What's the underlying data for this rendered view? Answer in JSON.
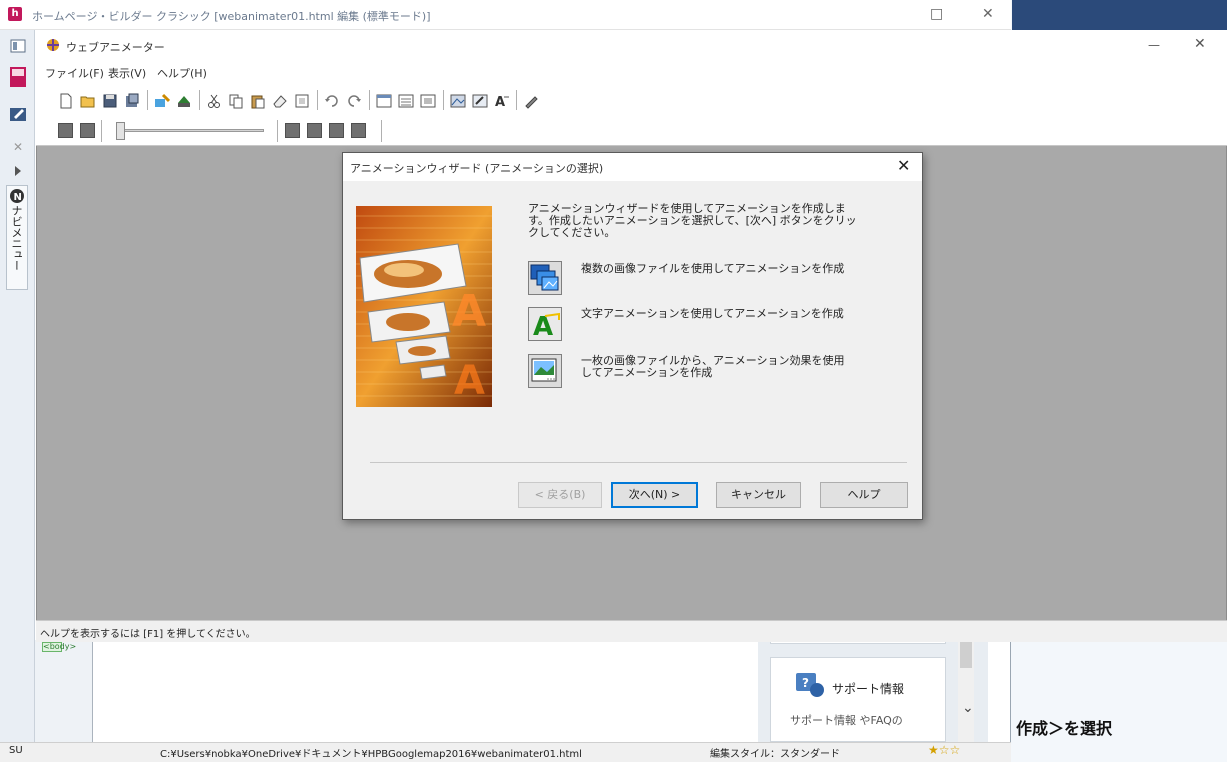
{
  "host": {
    "title": "ホームページ・ビルダー クラシック  [webanimater01.html 編集 (標準モード)]",
    "min_glyph": "□",
    "close_glyph": "✕",
    "navi_label": "ナビメニュー",
    "tag_label": "<body>",
    "support_title": "サポート情報",
    "support_sub": "サポート情報 やFAQの",
    "chev": "⌄",
    "status": {
      "mode": "SU",
      "path": "C:¥Users¥nobka¥OneDrive¥ドキュメント¥HPBGooglemap2016¥webanimater01.html",
      "style": "編集スタイル：スタンダード",
      "stars": "★☆☆"
    }
  },
  "right_caption": "作成＞を選択",
  "wa": {
    "title": "ウェブアニメーター",
    "min_glyph": "—",
    "close_glyph": "✕",
    "menu": [
      "ファイル(F)",
      "表示(V)",
      "ヘルプ(H)"
    ],
    "status_text": "ヘルプを表示するには [F1] を押してください。"
  },
  "dialog": {
    "title": "アニメーションウィザード (アニメーションの選択)",
    "close_glyph": "✕",
    "intro": "アニメーションウィザードを使用してアニメーションを作成します。作成したいアニメーションを選択して、[次へ] ボタンをクリックしてください。",
    "options": [
      {
        "label": "複数の画像ファイルを使用してアニメーションを作成",
        "icon": "multi-images-icon"
      },
      {
        "label": "文字アニメーションを使用してアニメーションを作成",
        "icon": "text-animation-icon"
      },
      {
        "label": "一枚の画像ファイルから、アニメーション効果を使用してアニメーションを作成",
        "icon": "single-image-icon"
      }
    ],
    "buttons": {
      "back": "< 戻る(B)",
      "next": "次へ(N) >",
      "cancel": "キャンセル",
      "help": "ヘルプ"
    }
  },
  "colors": {
    "accent": "#0078d7",
    "dialog_bg": "#f0f0f0",
    "workspace": "#a9a9a9"
  }
}
